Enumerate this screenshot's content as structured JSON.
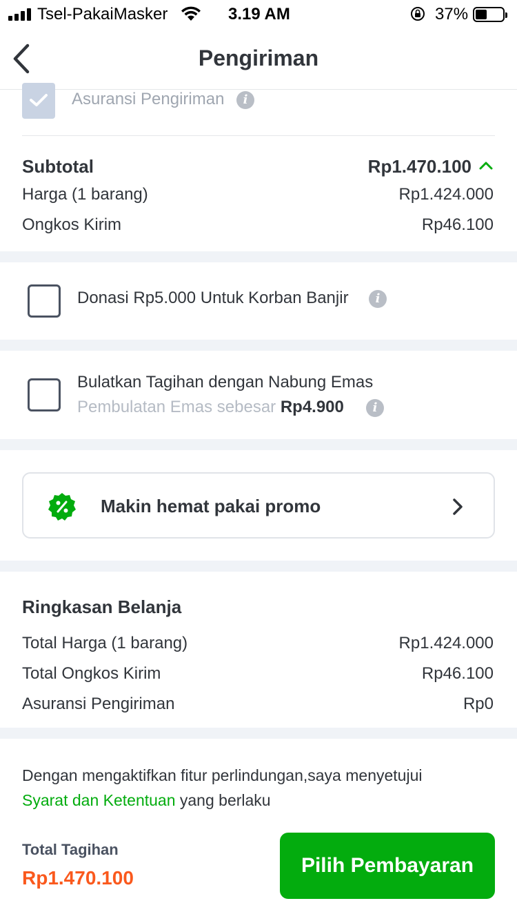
{
  "status_bar": {
    "carrier": "Tsel-PakaiMasker",
    "time": "3.19 AM",
    "battery_percent": "37%",
    "battery_level": 0.37
  },
  "header": {
    "title": "Pengiriman",
    "back_icon": "chevron-left-icon"
  },
  "insurance": {
    "label": "Asuransi Pengiriman",
    "checked": true,
    "disabled": true
  },
  "subtotal": {
    "label": "Subtotal",
    "value": "Rp1.470.100",
    "rows": [
      {
        "label": "Harga (1 barang)",
        "value": "Rp1.424.000"
      },
      {
        "label": "Ongkos Kirim",
        "value": "Rp46.100"
      }
    ]
  },
  "donation": {
    "label": "Donasi Rp5.000 Untuk Korban Banjir",
    "checked": false
  },
  "round_up": {
    "label": "Bulatkan Tagihan dengan Nabung Emas",
    "sub_prefix": "Pembulatan Emas sebesar",
    "sub_amount": "Rp4.900",
    "checked": false
  },
  "promo": {
    "label": "Makin hemat pakai promo",
    "icon": "discount-badge-icon"
  },
  "summary": {
    "title": "Ringkasan Belanja",
    "rows": [
      {
        "label": "Total Harga (1 barang)",
        "value": "Rp1.424.000"
      },
      {
        "label": "Total Ongkos Kirim",
        "value": "Rp46.100"
      },
      {
        "label": "Asuransi Pengiriman",
        "value": "Rp0"
      }
    ]
  },
  "terms": {
    "line1": "Dengan mengaktifkan fitur perlindungan,saya menyetujui",
    "link": "Syarat dan Ketentuan",
    "suffix": " yang berlaku"
  },
  "footer": {
    "total_label": "Total Tagihan",
    "total_value": "Rp1.470.100",
    "pay_button": "Pilih Pembayaran"
  },
  "colors": {
    "primary_green": "#03ac0e",
    "total_orange": "#fa591d",
    "text_dark": "#31353b",
    "separator": "#f0f3f7"
  }
}
